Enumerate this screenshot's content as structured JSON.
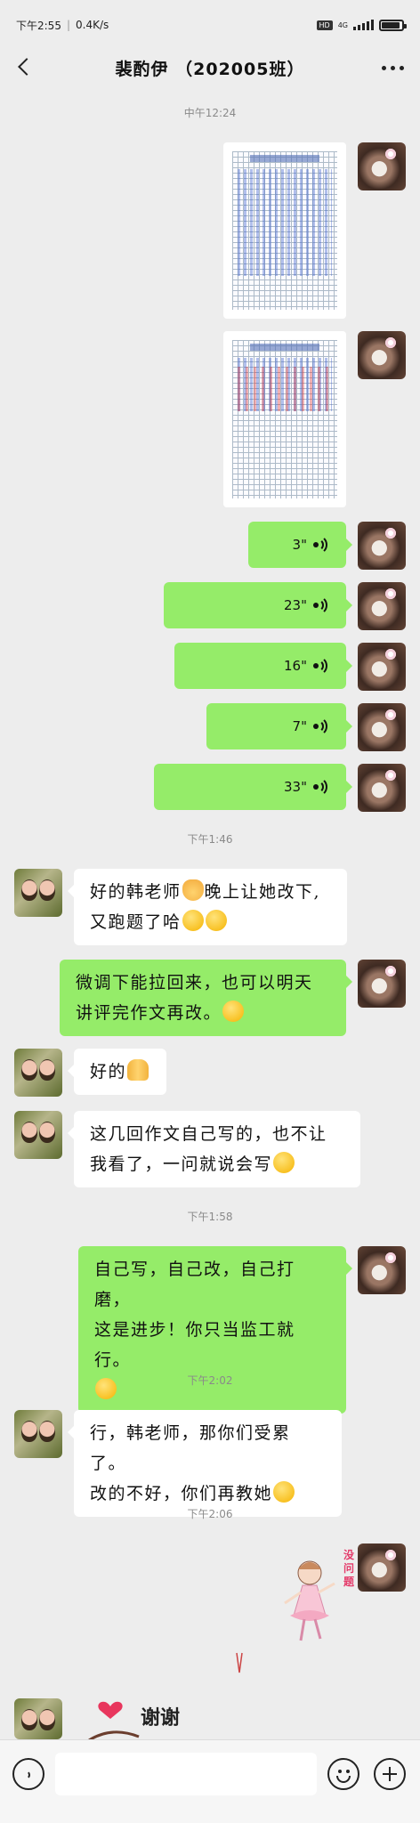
{
  "status_bar": {
    "time": "下午2:55",
    "network_speed": "0.4K/s",
    "hd_label": "HD",
    "network_type": "4G"
  },
  "header": {
    "title": "裴酌伊 （202005班）"
  },
  "timestamps": [
    "中午12:24",
    "下午1:46",
    "下午1:58",
    "下午2:02",
    "下午2:06"
  ],
  "voice_messages": [
    {
      "duration": "3\""
    },
    {
      "duration": "23\""
    },
    {
      "duration": "16\""
    },
    {
      "duration": "7\""
    },
    {
      "duration": "33\""
    }
  ],
  "messages": {
    "m1_line1": "好的韩老师",
    "m1_line1b": "晚上让她改下,",
    "m1_line2": "又跑题了哈",
    "m2_line1": "微调下能拉回来，也可以明天",
    "m2_line2": "讲评完作文再改。",
    "m3": "好的",
    "m4_line1": "这几回作文自己写的，也不让",
    "m4_line2": "我看了，一问就说会写",
    "m5_line1": "自己写，自己改，自己打磨，",
    "m5_line2": "这是进步！你只当监工就行。",
    "m6_line1": "行，韩老师，那你们受累了。",
    "m6_line2": "改的不好，你们再教她"
  },
  "stickers": {
    "no_problem": "没问题",
    "thanks": "谢谢"
  },
  "icons": {
    "back": "chevron-left-icon",
    "more": "more-dots-icon",
    "voice": "voice-wave-icon",
    "emoji": "smiley-icon",
    "plus": "plus-icon"
  },
  "colors": {
    "background": "#ededed",
    "my_bubble": "#95ec69",
    "other_bubble": "#ffffff"
  }
}
